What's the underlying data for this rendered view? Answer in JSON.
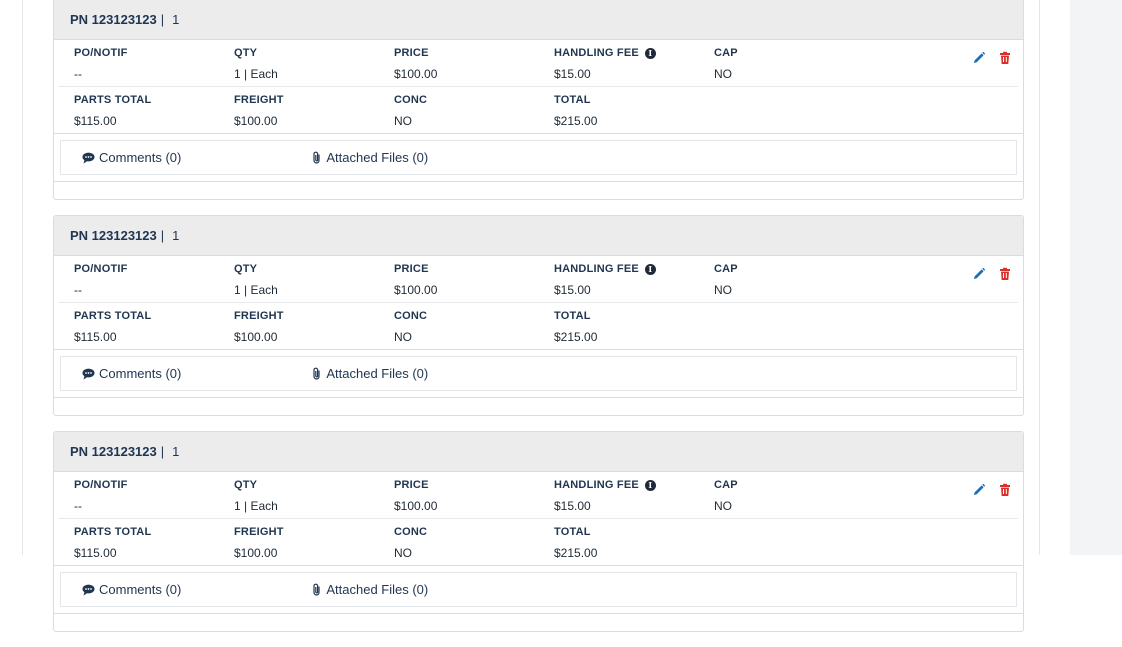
{
  "cards": [
    {
      "pn_label": "PN 123123123",
      "separator": "|",
      "count": "1",
      "fields_row1": [
        {
          "label": "PO/NOTIF",
          "value": "--"
        },
        {
          "label": "QTY",
          "value": "1 | Each"
        },
        {
          "label": "PRICE",
          "value": "$100.00"
        },
        {
          "label": "HANDLING FEE",
          "value": "$15.00"
        },
        {
          "label": "CAP",
          "value": "NO"
        }
      ],
      "fields_row2": [
        {
          "label": "PARTS TOTAL",
          "value": "$115.00"
        },
        {
          "label": "FREIGHT",
          "value": "$100.00"
        },
        {
          "label": "CONC",
          "value": "NO"
        },
        {
          "label": "TOTAL",
          "value": "$215.00"
        }
      ],
      "comments_label": "Comments (0)",
      "files_label": "Attached Files (0)"
    },
    {
      "pn_label": "PN 123123123",
      "separator": "|",
      "count": "1",
      "fields_row1": [
        {
          "label": "PO/NOTIF",
          "value": "--"
        },
        {
          "label": "QTY",
          "value": "1 | Each"
        },
        {
          "label": "PRICE",
          "value": "$100.00"
        },
        {
          "label": "HANDLING FEE",
          "value": "$15.00"
        },
        {
          "label": "CAP",
          "value": "NO"
        }
      ],
      "fields_row2": [
        {
          "label": "PARTS TOTAL",
          "value": "$115.00"
        },
        {
          "label": "FREIGHT",
          "value": "$100.00"
        },
        {
          "label": "CONC",
          "value": "NO"
        },
        {
          "label": "TOTAL",
          "value": "$215.00"
        }
      ],
      "comments_label": "Comments (0)",
      "files_label": "Attached Files (0)"
    },
    {
      "pn_label": "PN 123123123",
      "separator": "|",
      "count": "1",
      "fields_row1": [
        {
          "label": "PO/NOTIF",
          "value": "--"
        },
        {
          "label": "QTY",
          "value": "1 | Each"
        },
        {
          "label": "PRICE",
          "value": "$100.00"
        },
        {
          "label": "HANDLING FEE",
          "value": "$15.00"
        },
        {
          "label": "CAP",
          "value": "NO"
        }
      ],
      "fields_row2": [
        {
          "label": "PARTS TOTAL",
          "value": "$115.00"
        },
        {
          "label": "FREIGHT",
          "value": "$100.00"
        },
        {
          "label": "CONC",
          "value": "NO"
        },
        {
          "label": "TOTAL",
          "value": "$215.00"
        }
      ],
      "comments_label": "Comments (0)",
      "files_label": "Attached Files (0)"
    }
  ],
  "icons": {
    "edit": "pencil-icon",
    "delete": "trash-icon",
    "info": "info-circle-icon",
    "comments": "comment-icon",
    "files": "paperclip-icon"
  },
  "colors": {
    "edit": "#1e6fb5",
    "delete": "#d9302c",
    "header_bg": "#ececec",
    "text_dark": "#1f3550"
  }
}
